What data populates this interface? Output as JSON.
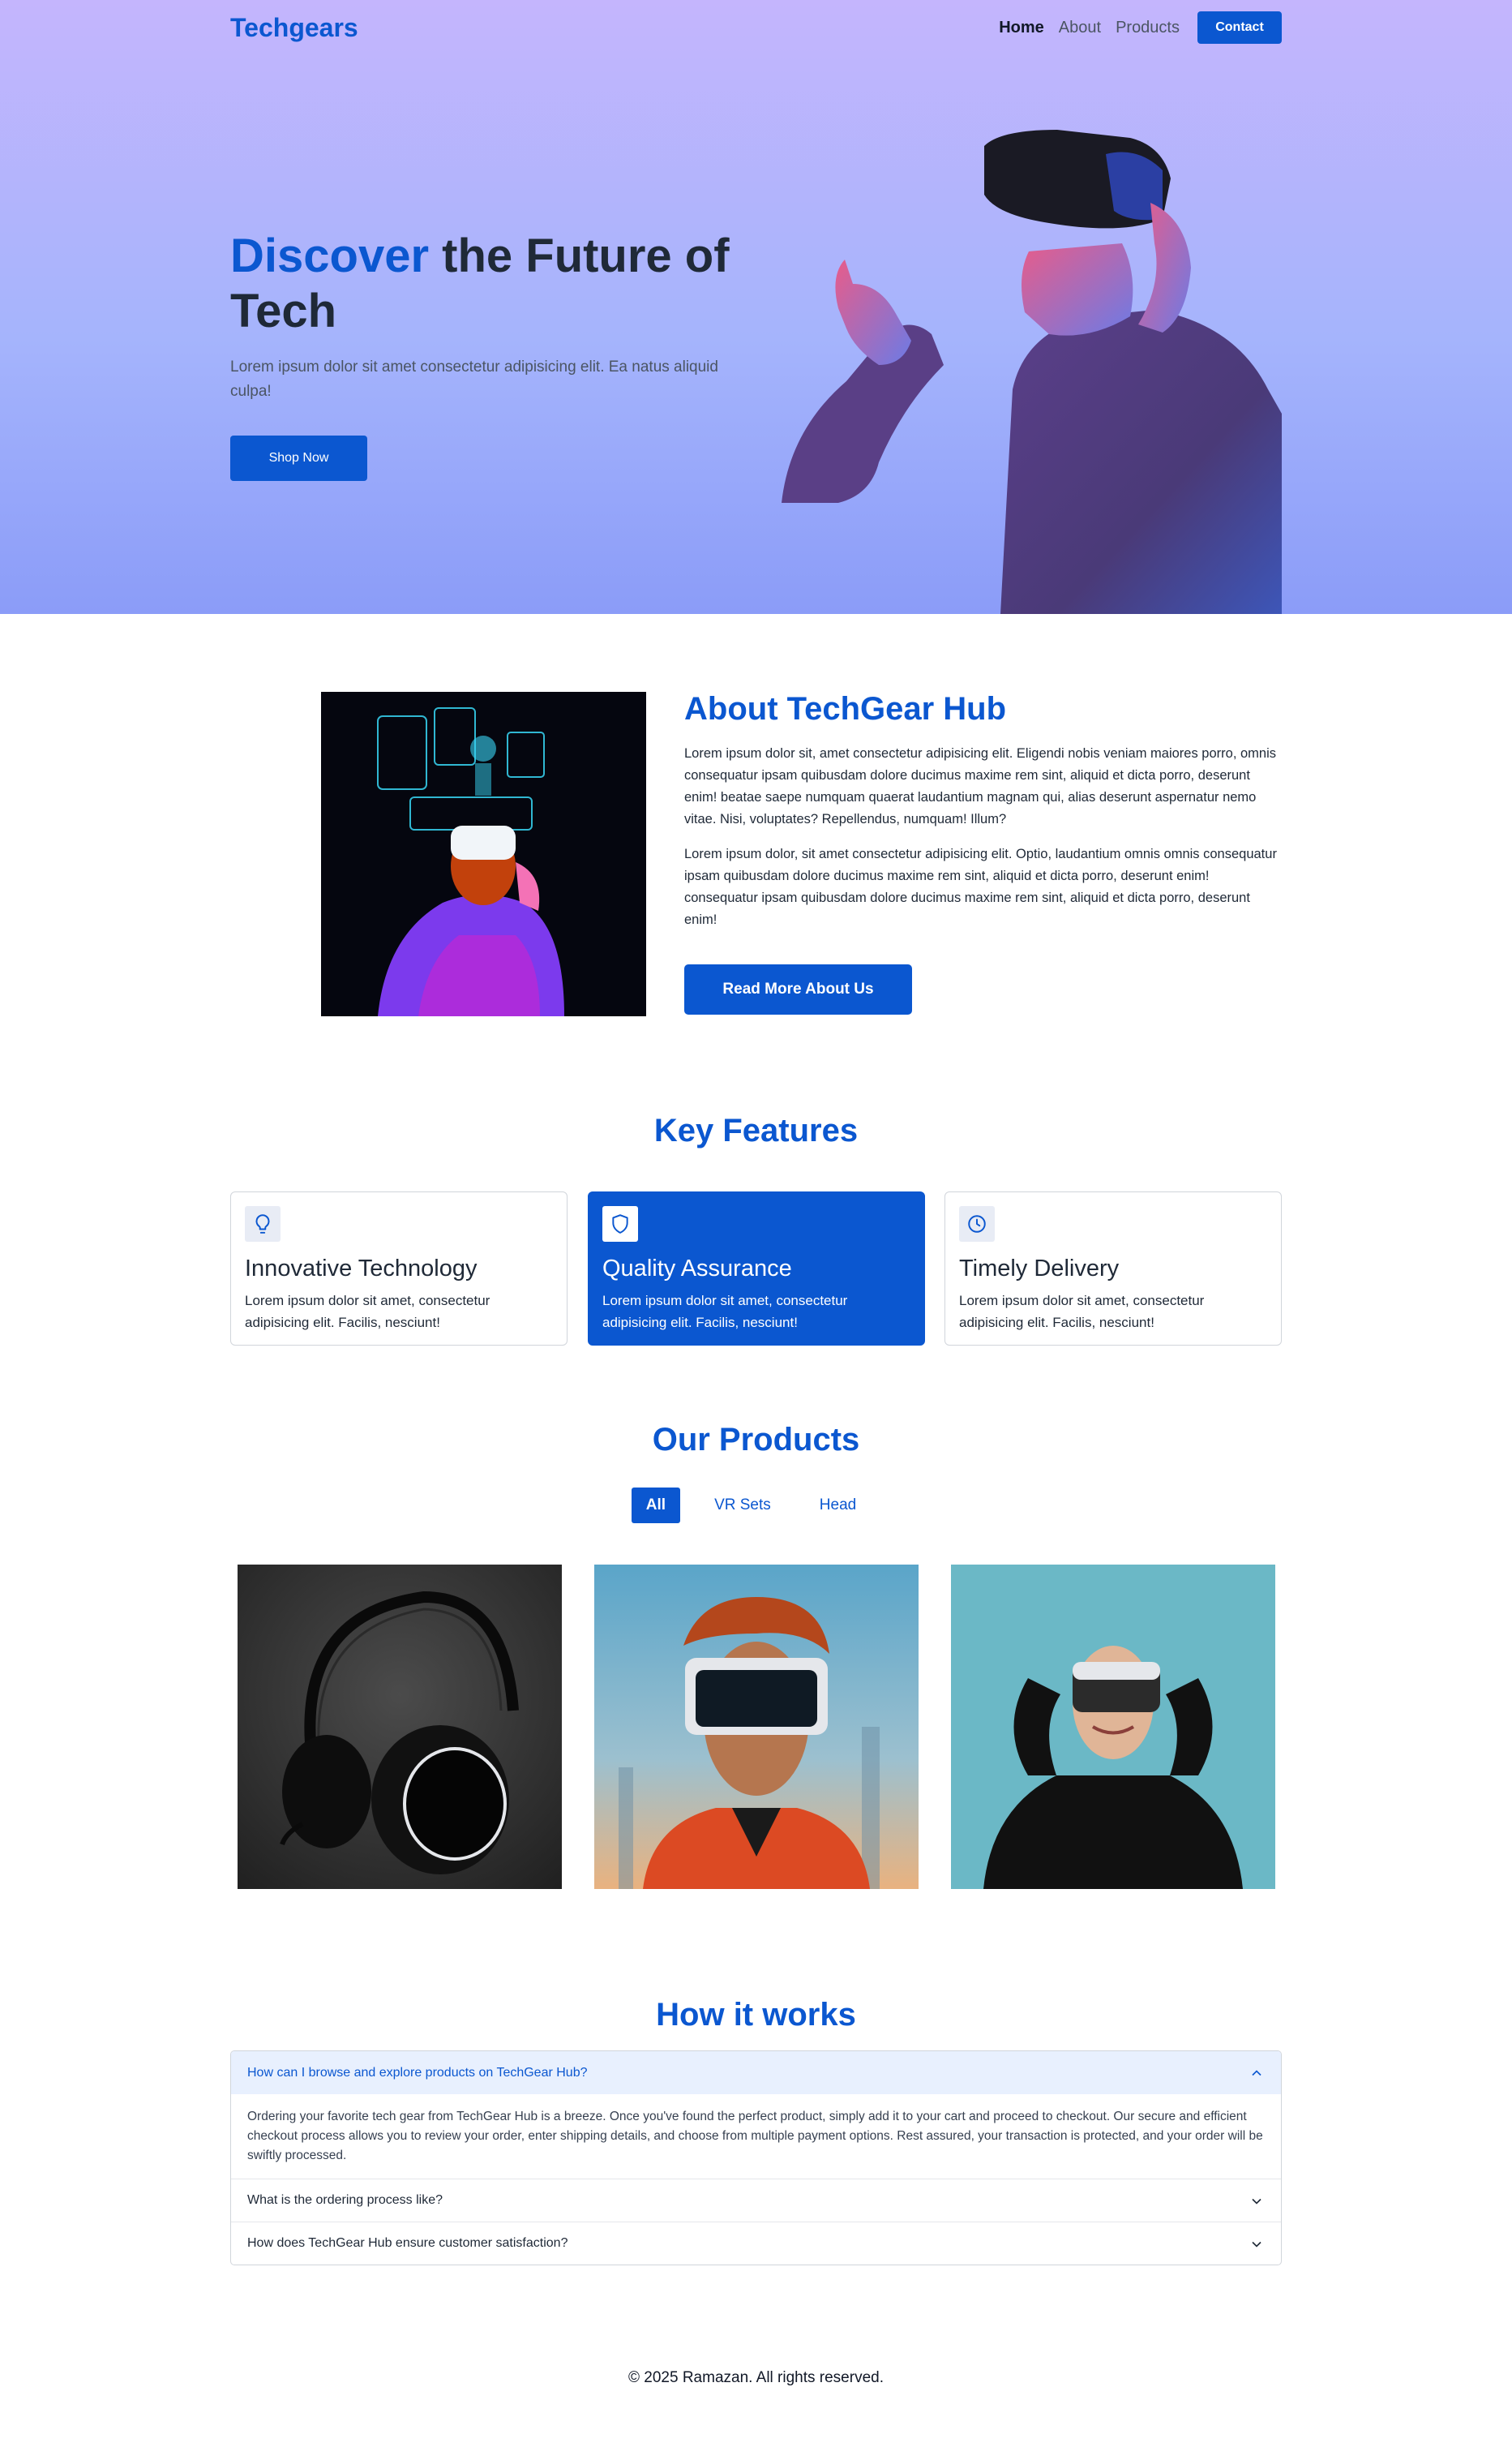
{
  "brand": {
    "logo": "Techgears",
    "accent_color": "#0b57d0"
  },
  "nav": {
    "links": [
      "Home",
      "About",
      "Products"
    ],
    "contact_label": "Contact"
  },
  "hero": {
    "title_accent": "Discover",
    "title_rest": " the Future of Tech",
    "description": "Lorem ipsum dolor sit amet consectetur adipisicing elit. Ea natus aliquid culpa!",
    "cta_label": "Shop Now"
  },
  "about": {
    "title": "About TechGear Hub",
    "paragraph_1": "Lorem ipsum dolor sit, amet consectetur adipisicing elit. Eligendi nobis veniam maiores porro, omnis consequatur ipsam quibusdam dolore ducimus maxime rem sint, aliquid et dicta porro, deserunt enim! beatae saepe numquam quaerat laudantium magnam qui, alias deserunt aspernatur nemo vitae. Nisi, voluptates? Repellendus, numquam! Illum?",
    "paragraph_2": "Lorem ipsum dolor, sit amet consectetur adipisicing elit. Optio, laudantium omnis omnis consequatur ipsam quibusdam dolore ducimus maxime rem sint, aliquid et dicta porro, deserunt enim! consequatur ipsam quibusdam dolore ducimus maxime rem sint, aliquid et dicta porro, deserunt enim!",
    "cta_label": "Read More About Us"
  },
  "features": {
    "title": "Key Features",
    "items": [
      {
        "icon": "lightbulb-icon",
        "title": "Innovative Technology",
        "description": "Lorem ipsum dolor sit amet, consectetur adipisicing elit. Facilis, nesciunt!"
      },
      {
        "icon": "shield-icon",
        "title": "Quality Assurance",
        "description": "Lorem ipsum dolor sit amet, consectetur adipisicing elit. Facilis, nesciunt!"
      },
      {
        "icon": "clock-icon",
        "title": "Timely Delivery",
        "description": "Lorem ipsum dolor sit amet, consectetur adipisicing elit. Facilis, nesciunt!"
      }
    ]
  },
  "products": {
    "title": "Our Products",
    "tabs": [
      "All",
      "VR Sets",
      "Head"
    ]
  },
  "faq": {
    "title": "How it works",
    "items": [
      {
        "question": "How can I browse and explore products on TechGear Hub?",
        "answer": "Ordering your favorite tech gear from TechGear Hub is a breeze. Once you've found the perfect product, simply add it to your cart and proceed to checkout. Our secure and efficient checkout process allows you to review your order, enter shipping details, and choose from multiple payment options. Rest assured, your transaction is protected, and your order will be swiftly processed."
      },
      {
        "question": "What is the ordering process like?"
      },
      {
        "question": "How does TechGear Hub ensure customer satisfaction?"
      }
    ]
  },
  "footer": {
    "text": "© 2025 Ramazan. All rights reserved."
  }
}
